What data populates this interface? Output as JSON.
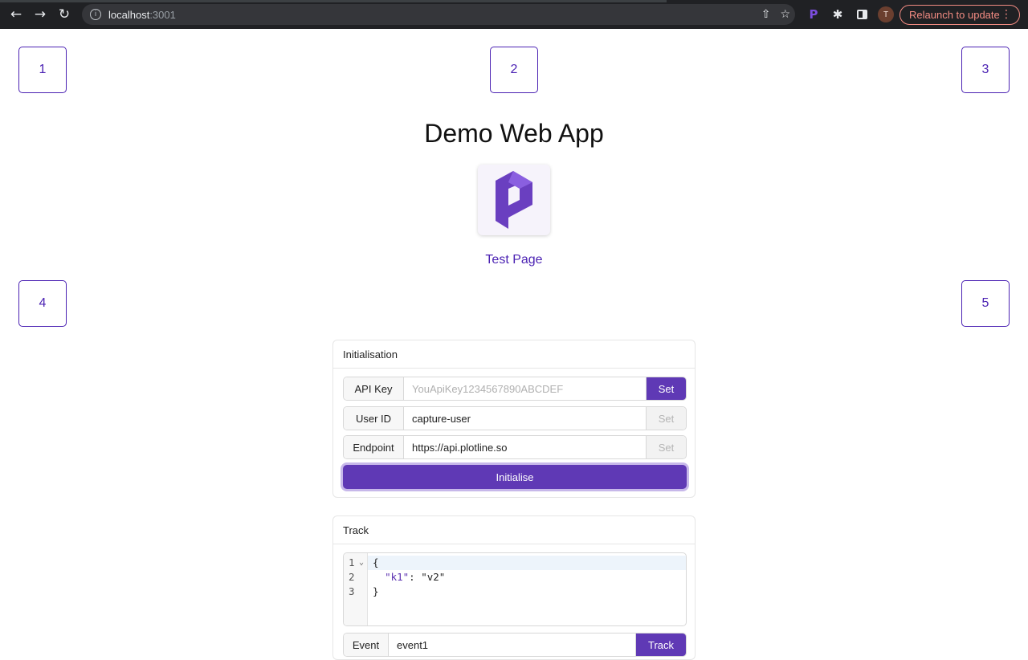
{
  "browser": {
    "url_host": "localhost",
    "url_port": ":3001",
    "relaunch_label": "Relaunch to update",
    "avatar_initial": "T",
    "extension_letter": "P"
  },
  "page": {
    "boxes": [
      "1",
      "2",
      "3",
      "4",
      "5"
    ],
    "title": "Demo Web App",
    "test_link": "Test Page"
  },
  "init": {
    "header": "Initialisation",
    "api_key_label": "API Key",
    "api_key_placeholder": "YouApiKey1234567890ABCDEF",
    "user_id_label": "User ID",
    "user_id_value": "capture-user",
    "endpoint_label": "Endpoint",
    "endpoint_value": "https://api.plotline.so",
    "set_label": "Set",
    "initialise_label": "Initialise"
  },
  "track": {
    "header": "Track",
    "code_lines": [
      "1",
      "2",
      "3"
    ],
    "code_open": "{",
    "code_key": "\"k1\"",
    "code_sep": ": ",
    "code_val": "\"v2\"",
    "code_close": "}",
    "event_label": "Event",
    "event_value": "event1",
    "track_label": "Track"
  },
  "colors": {
    "accent": "#5f39b5",
    "link": "#4b22b3",
    "chrome": "#202124"
  }
}
